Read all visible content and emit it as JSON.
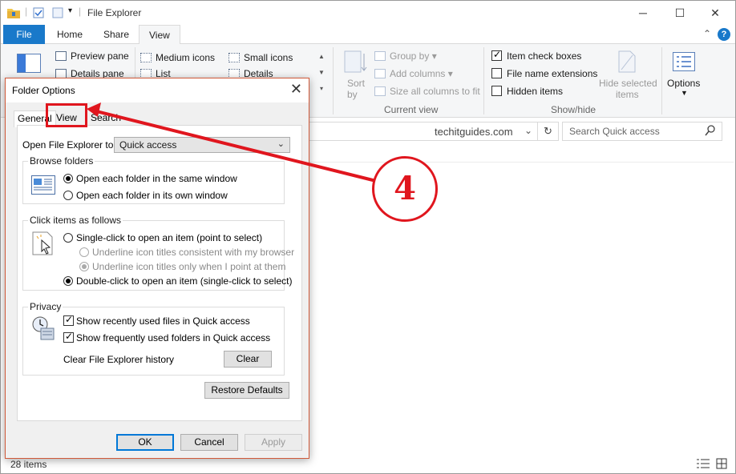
{
  "window": {
    "title": "File Explorer"
  },
  "ribbon_tabs": [
    {
      "label": "File"
    },
    {
      "label": "Home"
    },
    {
      "label": "Share"
    },
    {
      "label": "View"
    }
  ],
  "ribbon": {
    "preview_pane": "Preview pane",
    "details_pane": "Details pane",
    "medium_icons": "Medium icons",
    "small_icons": "Small icons",
    "list": "List",
    "details": "Details",
    "sort_by_line1": "Sort",
    "sort_by_line2": "by",
    "group_by": "Group by",
    "add_columns": "Add columns",
    "size_all_columns": "Size all columns to fit",
    "current_view_label": "Current view",
    "item_check_boxes": "Item check boxes",
    "file_name_extensions": "File name extensions",
    "hidden_items": "Hidden items",
    "hide_selected_line1": "Hide selected",
    "hide_selected_line2": "items",
    "show_hide_label": "Show/hide",
    "options": "Options"
  },
  "address_bar": {
    "text": "techitguides.com"
  },
  "search": {
    "placeholder": "Search Quick access"
  },
  "status_bar": {
    "items_count": "28 items"
  },
  "dialog": {
    "title": "Folder Options",
    "tabs": [
      {
        "label": "General"
      },
      {
        "label": "View"
      },
      {
        "label": "Search"
      }
    ],
    "open_explorer_label": "Open File Explorer to:",
    "open_explorer_value": "Quick access",
    "browse_folders": {
      "title": "Browse folders",
      "options": [
        {
          "label": "Open each folder in the same window"
        },
        {
          "label": "Open each folder in its own window"
        }
      ]
    },
    "click_items": {
      "title": "Click items as follows",
      "single_click": "Single-click to open an item (point to select)",
      "underline_browser": "Underline icon titles consistent with my browser",
      "underline_point": "Underline icon titles only when I point at them",
      "double_click": "Double-click to open an item (single-click to select)"
    },
    "privacy": {
      "title": "Privacy",
      "recent_files": "Show recently used files in Quick access",
      "frequent_folders": "Show frequently used folders in Quick access",
      "clear_history_label": "Clear File Explorer history",
      "clear_button": "Clear"
    },
    "restore_defaults": "Restore Defaults",
    "ok": "OK",
    "cancel": "Cancel",
    "apply": "Apply"
  },
  "annotation": {
    "number": "4",
    "color": "#e0161e"
  }
}
